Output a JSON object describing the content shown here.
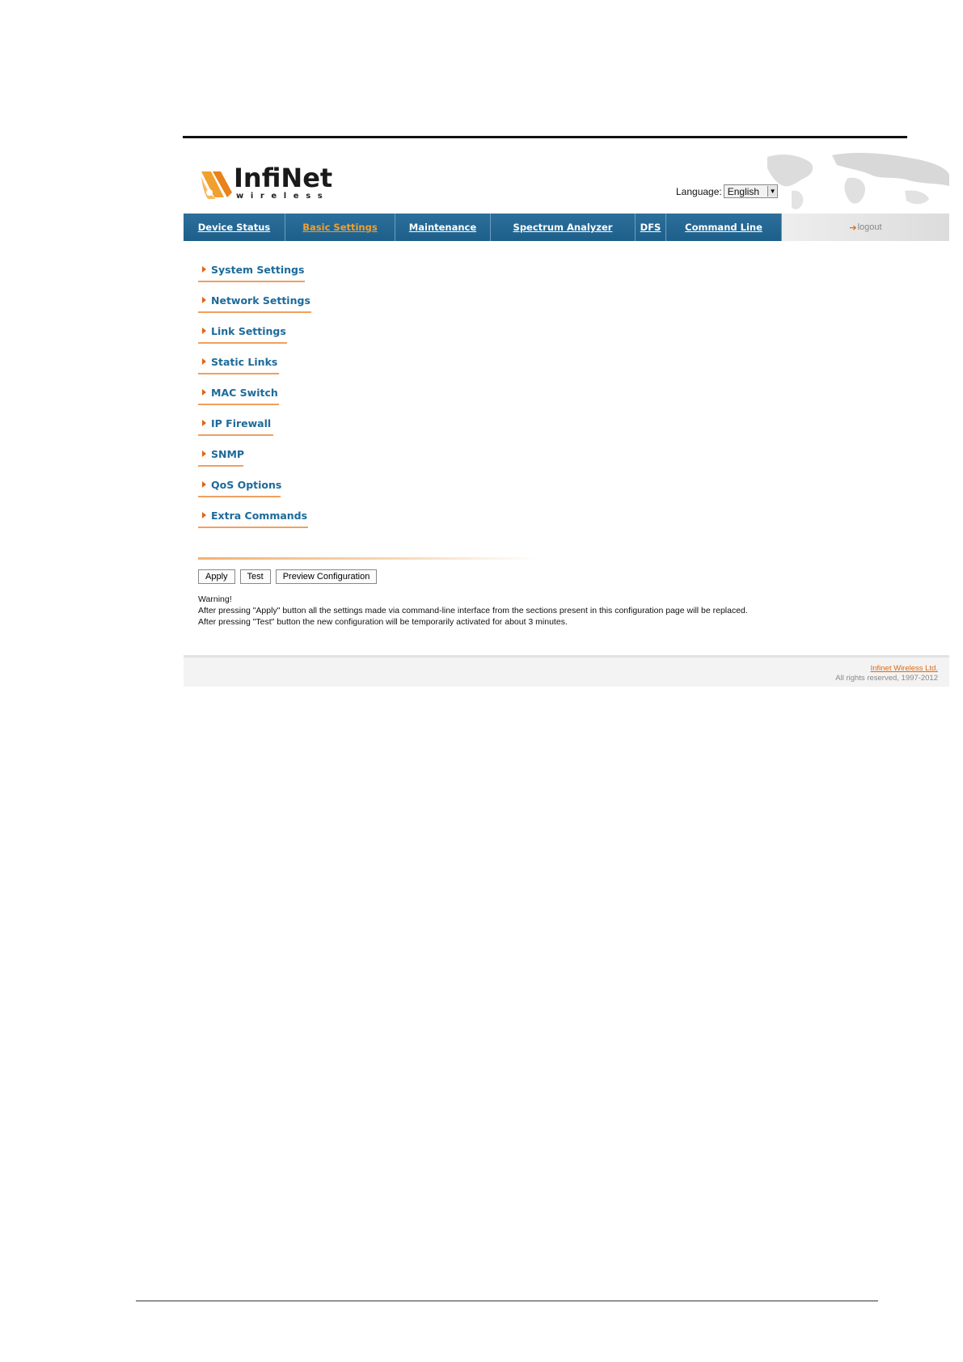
{
  "header": {
    "logo_word": "InfiNet",
    "logo_sub": "wireless",
    "language_label": "Language:",
    "language_value": "English"
  },
  "nav": {
    "items": [
      {
        "label": "Device Status"
      },
      {
        "label": "Basic Settings",
        "active": true
      },
      {
        "label": "Maintenance"
      },
      {
        "label": "Spectrum Analyzer"
      },
      {
        "label": "DFS"
      },
      {
        "label": "Command Line"
      }
    ],
    "logout": "logout"
  },
  "menu": {
    "items": [
      {
        "label": "System Settings"
      },
      {
        "label": "Network Settings"
      },
      {
        "label": "Link Settings"
      },
      {
        "label": "Static Links"
      },
      {
        "label": "MAC Switch"
      },
      {
        "label": "IP Firewall"
      },
      {
        "label": "SNMP"
      },
      {
        "label": "QoS Options"
      },
      {
        "label": "Extra Commands"
      }
    ]
  },
  "buttons": {
    "apply": "Apply",
    "test": "Test",
    "preview": "Preview Configuration"
  },
  "warning": {
    "title": "Warning!",
    "line1": "After pressing \"Apply\" button all the settings made via command-line interface from the sections present in this configuration page will be replaced.",
    "line2": "After pressing \"Test\" button the new configuration will be temporarily activated for about 3 minutes."
  },
  "footer": {
    "company": "Infinet Wireless Ltd.",
    "copyright": "All rights reserved, 1997-2012"
  },
  "colors": {
    "nav_blue": "#1d5f8a",
    "accent_orange": "#e0641a",
    "menu_text": "#1d6a9a"
  }
}
